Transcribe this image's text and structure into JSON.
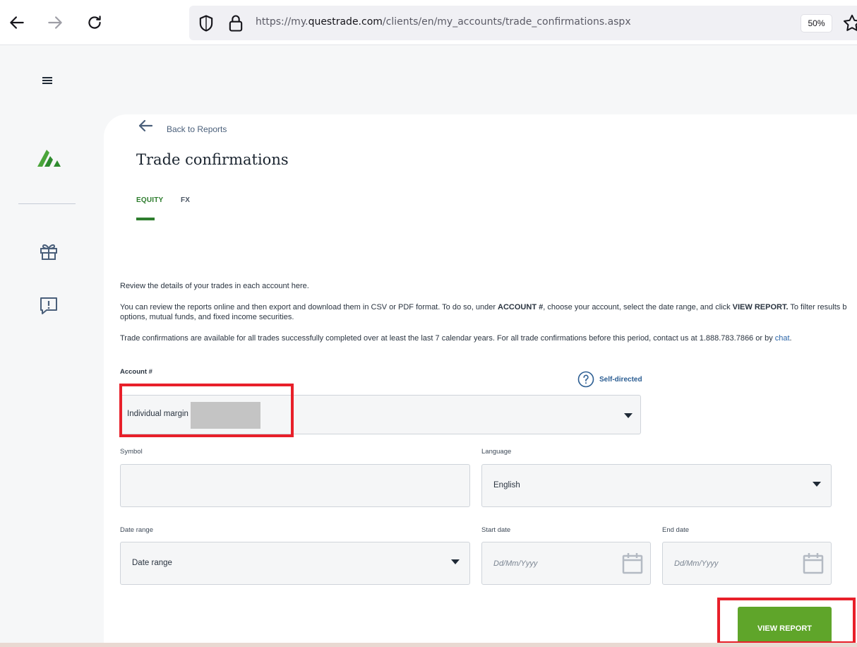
{
  "browser": {
    "url_prefix": "https://my.",
    "url_domain": "questrade.com",
    "url_path": "/clients/en/my_accounts/trade_confirmations.aspx",
    "zoom": "50%"
  },
  "sidebar": {
    "icons": [
      "menu-icon",
      "brand-logo",
      "gift-icon",
      "feedback-icon"
    ]
  },
  "page": {
    "back_label": "Back to Reports",
    "title": "Trade confirmations",
    "tabs": [
      {
        "label": "EQUITY",
        "active": true
      },
      {
        "label": "FX",
        "active": false
      }
    ],
    "intro": "Review the details of your trades in each account here.",
    "instructions": {
      "part1": "You can review the reports online and then export and download them in CSV or PDF format. To do so, under ",
      "bold1": "ACCOUNT #",
      "part2": ", choose your account, select the date range, and click ",
      "bold2": "VIEW REPORT.",
      "part3": " To filter results b",
      "line2": "options, mutual funds, and fixed income securities."
    },
    "availability": {
      "text": "Trade confirmations are available for all trades successfully completed over at least the last 7 calendar years. For all trade confirmations before this period, contact us at 1.888.783.7866 or by ",
      "link": "chat",
      "end": "."
    }
  },
  "form": {
    "account_label": "Account #",
    "account_type": "Self-directed",
    "account_value": "Individual margin",
    "symbol_label": "Symbol",
    "symbol_value": "",
    "language_label": "Language",
    "language_value": "English",
    "date_range_label": "Date range",
    "date_range_value": "Date range",
    "start_date_label": "Start date",
    "start_date_placeholder": "Dd/Mm/Yyyy",
    "end_date_label": "End date",
    "end_date_placeholder": "Dd/Mm/Yyyy",
    "submit_label": "VIEW REPORT"
  },
  "colors": {
    "accent_green": "#2e7d2e",
    "button_green": "#5fa52a",
    "highlight_red": "#e8202a",
    "link_blue": "#2b65a8"
  }
}
